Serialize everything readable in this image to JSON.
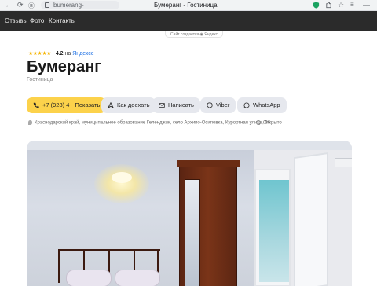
{
  "browser": {
    "url": "bumerang-hotel.clients.site",
    "tab_title": "Бумеранг - Гостиница"
  },
  "nav": {
    "items": [
      "Отзывы",
      "Фото",
      "Контакты"
    ]
  },
  "created_with": "Сайт создается ◉ Яндекс",
  "rating": {
    "stars": "★★★★★",
    "score": "4.2",
    "on_label": "на",
    "provider": "Яндексе"
  },
  "business": {
    "name": "Бумеранг",
    "category": "Гостиница"
  },
  "actions": {
    "phone_number": "+7 (928) 4",
    "phone_show": "Показать",
    "route": "Как доехать",
    "write": "Написать",
    "viber": "Viber",
    "whatsapp": "WhatsApp"
  },
  "address": "Краснодарский край, муниципальное образование Геленджик, село Архипо-Осиповка, Курортная улица, 36",
  "status": "Открыто",
  "colors": {
    "topbar": "#2b2b2b",
    "phone_button": "#fcd24b",
    "button": "#e6e8ee",
    "accent_link": "#1a6ee3"
  }
}
